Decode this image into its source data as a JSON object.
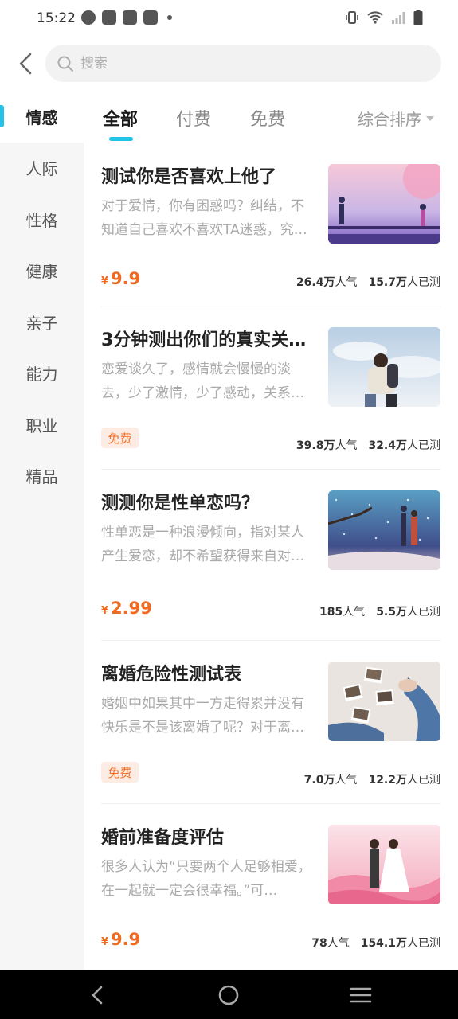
{
  "status_bar": {
    "time": "15:22"
  },
  "search": {
    "placeholder": "搜索"
  },
  "sidebar": {
    "items": [
      {
        "label": "情感",
        "active": true
      },
      {
        "label": "人际"
      },
      {
        "label": "性格"
      },
      {
        "label": "健康"
      },
      {
        "label": "亲子"
      },
      {
        "label": "能力"
      },
      {
        "label": "职业"
      },
      {
        "label": "精品"
      }
    ]
  },
  "filters": {
    "tabs": [
      {
        "label": "全部",
        "active": true
      },
      {
        "label": "付费"
      },
      {
        "label": "免费"
      }
    ],
    "sort_label": "综合排序"
  },
  "items": [
    {
      "title": "测试你是否喜欢上他了",
      "desc": "对于爱情，你有困惑吗？纠结，不知道自己喜欢不喜欢TA迷惑，究…",
      "price_symbol": "¥",
      "price": "9.9",
      "popularity_num": "26.4万",
      "popularity_unit": "人气",
      "tested_num": "15.7万",
      "tested_unit": "人已测",
      "thumb": "thumb-love-couple"
    },
    {
      "title": "3分钟测出你们的真实关…",
      "desc": "恋爱谈久了，感情就会慢慢的淡去，少了激情，少了感动，关系…",
      "badge": "免费",
      "popularity_num": "39.8万",
      "popularity_unit": "人气",
      "tested_num": "32.4万",
      "tested_unit": "人已测",
      "thumb": "thumb-hug"
    },
    {
      "title": "测测你是性单恋吗？",
      "desc": "性单恋是一种浪漫倾向，指对某人产生爱恋，却不希望获得来自对…",
      "price_symbol": "¥",
      "price": "2.99",
      "popularity_num": "185",
      "popularity_unit": "人气",
      "tested_num": "5.5万",
      "tested_unit": "人已测",
      "thumb": "thumb-snow-couple"
    },
    {
      "title": "离婚危险性测试表",
      "desc": "婚姻中如果其中一方走得累并没有快乐是不是该离婚了呢？对于离…",
      "badge": "免费",
      "popularity_num": "7.0万",
      "popularity_unit": "人气",
      "tested_num": "12.2万",
      "tested_unit": "人已测",
      "thumb": "thumb-photos"
    },
    {
      "title": "婚前准备度评估",
      "desc": "很多人认为“只要两个人足够相爱，在一起就一定会很幸福。”可…",
      "price_symbol": "¥",
      "price": "9.9",
      "popularity_num": "78",
      "popularity_unit": "人气",
      "tested_num": "154.1万",
      "tested_unit": "人已测",
      "thumb": "thumb-wedding"
    }
  ]
}
